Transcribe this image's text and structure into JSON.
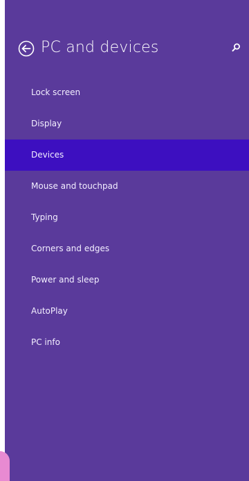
{
  "colors": {
    "panel_background": "#5a3a9b",
    "selected_background": "#3d0fc0",
    "text": "#ffffff",
    "corner_accent": "#e88ad2"
  },
  "header": {
    "title": "PC and devices",
    "back_icon": "back-arrow-circle-icon",
    "search_icon": "search-icon"
  },
  "nav": {
    "selected_index": 2,
    "items": [
      {
        "label": "Lock screen"
      },
      {
        "label": "Display"
      },
      {
        "label": "Devices"
      },
      {
        "label": "Mouse and touchpad"
      },
      {
        "label": "Typing"
      },
      {
        "label": "Corners and edges"
      },
      {
        "label": "Power and sleep"
      },
      {
        "label": "AutoPlay"
      },
      {
        "label": "PC info"
      }
    ]
  }
}
